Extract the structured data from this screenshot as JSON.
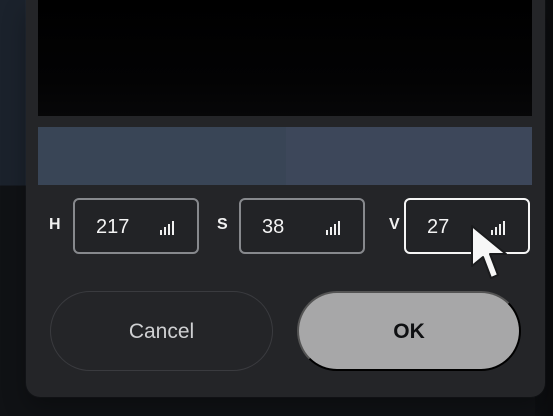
{
  "hsv": {
    "h_label": "H",
    "h_value": "217",
    "s_label": "S",
    "s_value": "38",
    "v_label": "V",
    "v_value": "27"
  },
  "buttons": {
    "cancel_label": "Cancel",
    "ok_label": "OK"
  },
  "colors": {
    "background": "#1b222c",
    "dialog": "#242528",
    "swatch_left": "#394556",
    "swatch_right": "#3d475a",
    "ok_button": "#a7a7a8",
    "focused_border": "#f5f5f5"
  },
  "icons": {
    "field_adjust": "signal-bars-icon",
    "cursor": "mouse-pointer-icon"
  }
}
